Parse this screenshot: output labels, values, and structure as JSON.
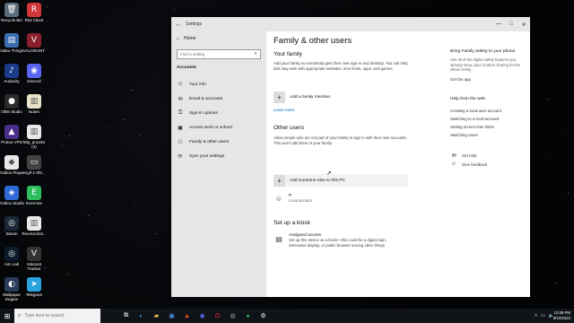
{
  "desktop": {
    "icons": [
      {
        "label": "Recycle Bin",
        "glyph": "🗑",
        "color": "#5a6b7a"
      },
      {
        "label": "Riot Client",
        "glyph": "R",
        "color": "#d13639"
      },
      {
        "label": "Video Things",
        "glyph": "▤",
        "color": "#3b6fb0"
      },
      {
        "label": "VALORANT",
        "glyph": "V",
        "color": "#8a1f2d"
      },
      {
        "label": "Audacity",
        "glyph": "♪",
        "color": "#1a3c8a"
      },
      {
        "label": "Discord",
        "glyph": "◉",
        "color": "#5865f2"
      },
      {
        "label": "OBS Studio",
        "glyph": "●",
        "color": "#2a2a2a"
      },
      {
        "label": "Notes",
        "glyph": "▥",
        "color": "#e8e2c8"
      },
      {
        "label": "Proton VPN",
        "glyph": "▲",
        "color": "#4a2f8a"
      },
      {
        "label": "http_proxies (4)",
        "glyph": "▥",
        "color": "#e8e8e8"
      },
      {
        "label": "Roblox Player",
        "glyph": "◆",
        "color": "#e8e8e8"
      },
      {
        "label": "ezgif-1-0f4...",
        "glyph": "▭",
        "color": "#444"
      },
      {
        "label": "Roblox Studio",
        "glyph": "◈",
        "color": "#2f6ad6"
      },
      {
        "label": "Evernote",
        "glyph": "E",
        "color": "#2dbe60"
      },
      {
        "label": "Steam",
        "glyph": "◎",
        "color": "#1b2838"
      },
      {
        "label": "RevoUninst...",
        "glyph": "▥",
        "color": "#e8e8e8"
      },
      {
        "label": "Aim Lab",
        "glyph": "◎",
        "color": "#0a1a2a"
      },
      {
        "label": "Valorant Tracker",
        "glyph": "V",
        "color": "#333"
      },
      {
        "label": "Wallpaper Engine",
        "glyph": "◐",
        "color": "#2a3c5a"
      },
      {
        "label": "Telegram",
        "glyph": "➤",
        "color": "#2aa3df"
      }
    ]
  },
  "window": {
    "title": "Settings",
    "back_icon": "←",
    "controls": {
      "minimize": "—",
      "maximize": "□",
      "close": "✕"
    }
  },
  "sidebar": {
    "home_label": "Home",
    "search_placeholder": "Find a setting",
    "section_title": "Accounts",
    "items": [
      {
        "label": "Your info",
        "icon": "user-icon",
        "glyph": "☺"
      },
      {
        "label": "Email & accounts",
        "icon": "mail-icon",
        "glyph": "✉"
      },
      {
        "label": "Sign-in options",
        "icon": "key-icon",
        "glyph": "⚿"
      },
      {
        "label": "Access work or school",
        "icon": "briefcase-icon",
        "glyph": "▣"
      },
      {
        "label": "Family & other users",
        "icon": "people-icon",
        "glyph": "⚇"
      },
      {
        "label": "Sync your settings",
        "icon": "sync-icon",
        "glyph": "⟳"
      }
    ]
  },
  "main": {
    "page_title": "Family & other users",
    "your_family": {
      "heading": "Your family",
      "description": "Add your family so everybody gets their own sign-in and desktop. You can help kids stay safe with appropriate websites, time limits, apps, and games.",
      "add_label": "Add a family member",
      "learn_more": "Learn more"
    },
    "other_users": {
      "heading": "Other users",
      "description": "Allow people who are not part of your family to sign in with their own accounts. This won't add them to your family.",
      "add_label": "Add someone else to this PC",
      "user_name": "P",
      "user_type": "Local account"
    },
    "kiosk": {
      "heading": "Set up a kiosk",
      "item_title": "Assigned access",
      "item_description": "Set up this device as a kiosk—this could be a digital sign, interactive display, or public browser among other things."
    }
  },
  "aside": {
    "family_safety_title": "Bring Family Safety to your phone",
    "family_safety_text": "Use all of the digital safety features you already know, plus location sharing for the whole family.",
    "get_app": "Get the app",
    "help_title": "Help from the web",
    "help_links": [
      "Creating a local user account",
      "Switching to a local account",
      "Setting screen time limits",
      "Switching users"
    ],
    "get_help": "Get help",
    "give_feedback": "Give feedback"
  },
  "taskbar": {
    "search_placeholder": "Type here to search",
    "apps": [
      {
        "name": "task-view",
        "glyph": "⧉",
        "color": "#ffffff"
      },
      {
        "name": "edge",
        "glyph": "◐",
        "color": "#2fa3e0"
      },
      {
        "name": "file-explorer",
        "glyph": "▰",
        "color": "#f3c14b"
      },
      {
        "name": "store",
        "glyph": "▣",
        "color": "#4a8ad8"
      },
      {
        "name": "brave",
        "glyph": "▲",
        "color": "#f15a22"
      },
      {
        "name": "discord",
        "glyph": "◉",
        "color": "#5865f2"
      },
      {
        "name": "opera",
        "glyph": "O",
        "color": "#ff1b2d"
      },
      {
        "name": "steam",
        "glyph": "◎",
        "color": "#c7d5e0"
      },
      {
        "name": "spotify",
        "glyph": "●",
        "color": "#1db954"
      },
      {
        "name": "settings",
        "glyph": "⚙",
        "color": "#ffffff"
      }
    ],
    "time": "12:09 PM",
    "date": "8/10/2023"
  },
  "colors": {
    "sidebar_bg": "#e6e6e6",
    "link": "#0063b1",
    "taskbar": "#101318"
  }
}
